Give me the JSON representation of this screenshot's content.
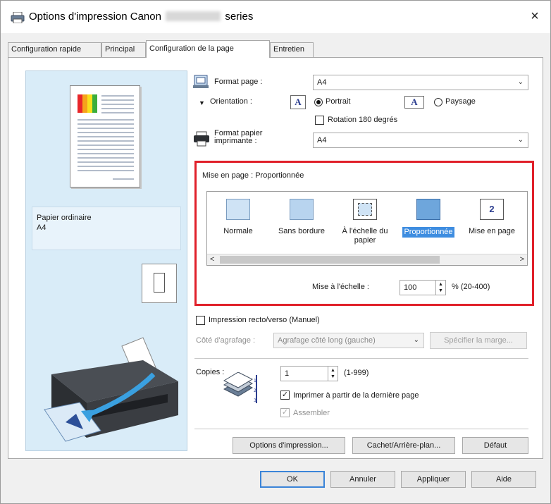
{
  "window": {
    "title_prefix": "Options d'impression Canon",
    "title_suffix": "series",
    "close_glyph": "×"
  },
  "tabs": [
    {
      "label": "Configuration rapide"
    },
    {
      "label": "Principal"
    },
    {
      "label": "Configuration de la page"
    },
    {
      "label": "Entretien"
    }
  ],
  "preview": {
    "paper_type": "Papier ordinaire",
    "paper_size": "A4"
  },
  "page_setup": {
    "page_size_label": "Format page :",
    "page_size_value": "A4",
    "orientation_label": "Orientation :",
    "portrait_label": "Portrait",
    "landscape_label": "Paysage",
    "orientation_selected": "Portrait",
    "rotate_label": "Rotation 180 degrés",
    "rotate_checked": false,
    "printer_paper_label_1": "Format papier",
    "printer_paper_label_2": "imprimante :",
    "printer_paper_value": "A4"
  },
  "layout": {
    "heading": "Mise en page : Proportionnée",
    "items": [
      {
        "label": "Normale"
      },
      {
        "label": "Sans bordure"
      },
      {
        "label": "À l'échelle du papier"
      },
      {
        "label": "Proportionnée"
      },
      {
        "label": "Mise en page"
      }
    ],
    "selected": "Proportionnée",
    "scaling_label": "Mise à l'échelle :",
    "scaling_value": "100",
    "scaling_range": "% (20-400)"
  },
  "duplex": {
    "label": "Impression recto/verso (Manuel)",
    "checked": false,
    "stapling_label": "Côté d'agrafage :",
    "stapling_value": "Agrafage côté long (gauche)",
    "margin_button": "Spécifier la marge..."
  },
  "copies": {
    "label": "Copies :",
    "value": "1",
    "range": "(1-999)",
    "reverse_label": "Imprimer à partir de la dernière page",
    "reverse_checked": true,
    "collate_label": "Assembler",
    "collate_checked": true
  },
  "panel_buttons": {
    "print_options": "Options d'impression...",
    "stamp_background": "Cachet/Arrière-plan...",
    "defaults": "Défaut"
  },
  "dialog_buttons": {
    "ok": "OK",
    "cancel": "Annuler",
    "apply": "Appliquer",
    "help": "Aide"
  },
  "colors": {
    "highlight_border": "#e0202a",
    "selection": "#3e8de0",
    "preview_bg": "#d9ecf8"
  }
}
